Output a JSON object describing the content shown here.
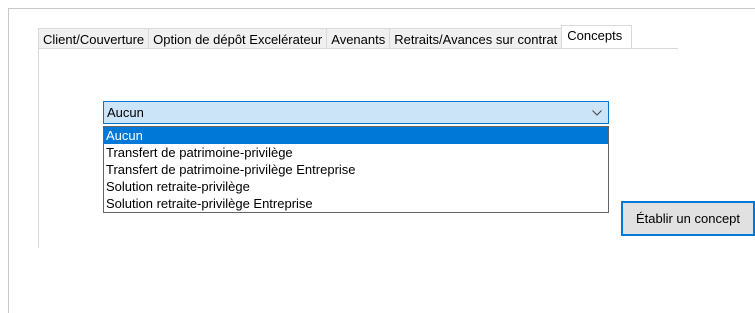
{
  "tabs": [
    {
      "label": "Client/Couverture",
      "active": false
    },
    {
      "label": "Option de dépôt Excelérateur",
      "active": false
    },
    {
      "label": "Avenants",
      "active": false
    },
    {
      "label": "Retraits/Avances sur contrat",
      "active": false
    },
    {
      "label": "Concepts",
      "active": true
    }
  ],
  "concept_combo": {
    "value": "Aucun",
    "icon": "chevron-down-icon",
    "options": [
      "Aucun",
      "Transfert de patrimoine-privilège",
      "Transfert de patrimoine-privilège Entreprise",
      "Solution retraite-privilège",
      "Solution retraite-privilège Entreprise"
    ],
    "selected_index": 0
  },
  "actions": {
    "establish_label": "Établir un concept"
  },
  "colors": {
    "accent": "#0078d7",
    "combo_bg": "#cce4f7",
    "button_bg": "#e1e1e1",
    "tab_bg": "#f0f0f0"
  }
}
